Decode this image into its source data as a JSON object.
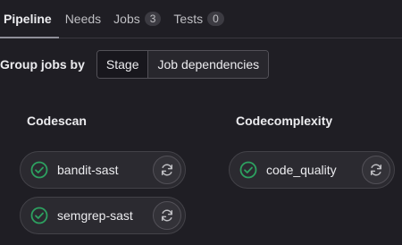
{
  "tabs": [
    {
      "label": "Pipeline",
      "active": true
    },
    {
      "label": "Needs"
    },
    {
      "label": "Jobs",
      "count": "3"
    },
    {
      "label": "Tests",
      "count": "0"
    }
  ],
  "group_by": {
    "label": "Group jobs by",
    "options": [
      "Stage",
      "Job dependencies"
    ],
    "selected": "Stage"
  },
  "stages": [
    {
      "name": "Codescan",
      "jobs": [
        {
          "name": "bandit-sast",
          "status": "success",
          "status_icon": "check-circle-icon",
          "action_icon": "retry-icon"
        },
        {
          "name": "semgrep-sast",
          "status": "success",
          "status_icon": "check-circle-icon",
          "action_icon": "retry-icon"
        }
      ]
    },
    {
      "name": "Codecomplexity",
      "jobs": [
        {
          "name": "code_quality",
          "status": "success",
          "status_icon": "check-circle-icon",
          "action_icon": "retry-icon"
        }
      ]
    }
  ],
  "colors": {
    "background": "#1f1e24",
    "success": "#2da160",
    "text": "#ececef",
    "muted": "#bfbfc3"
  }
}
